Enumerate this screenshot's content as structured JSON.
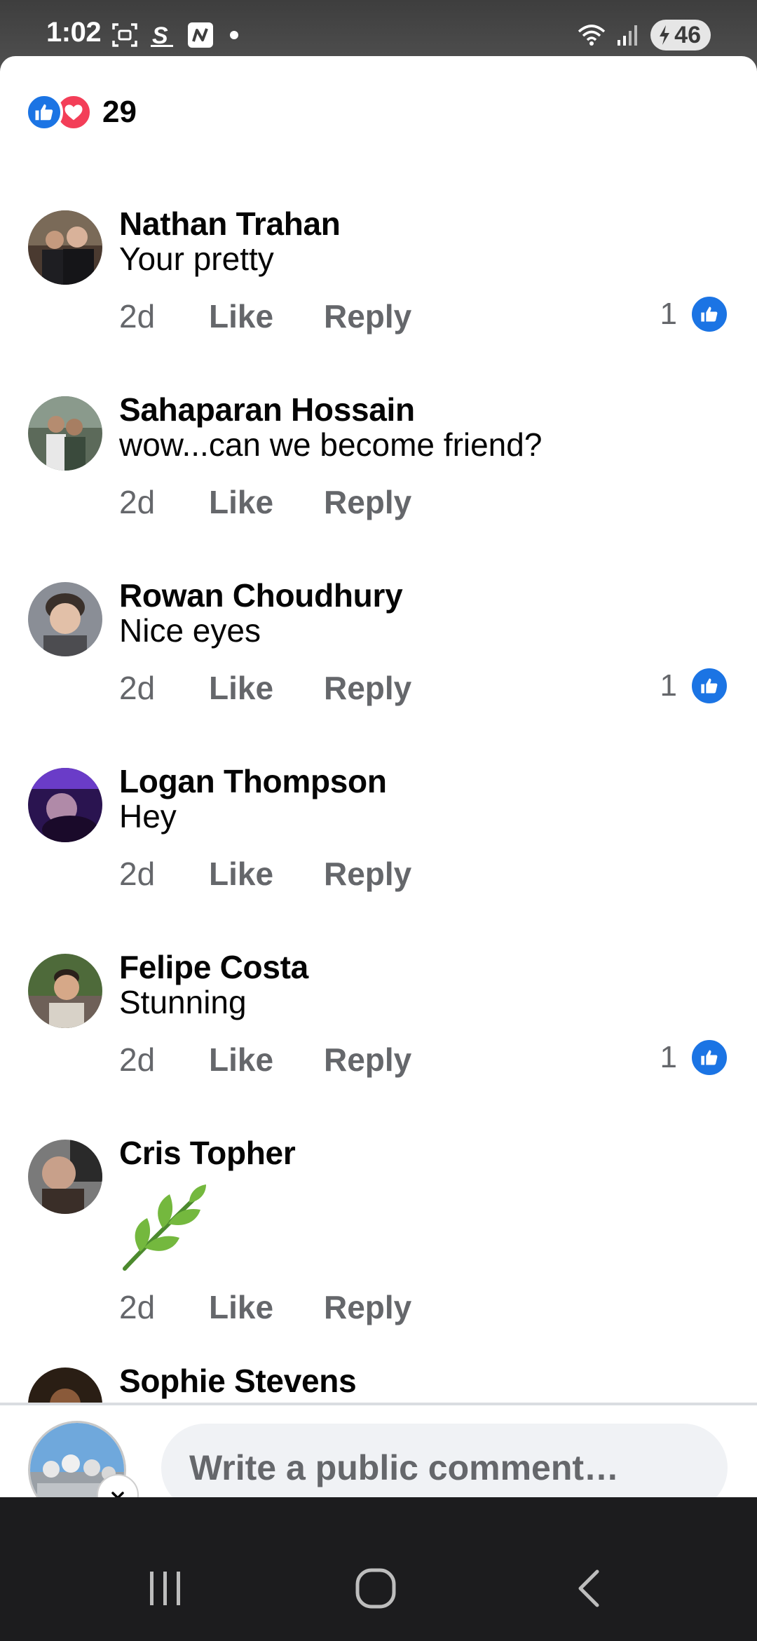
{
  "status_bar": {
    "time": "1:02",
    "left_icons": [
      "screenshot-icon",
      "s-app-icon",
      "n-app-icon",
      "notification-dot"
    ],
    "right_icons": [
      "wifi-icon",
      "signal-icon"
    ],
    "battery": "46"
  },
  "reactions": {
    "types": [
      "like",
      "love"
    ],
    "count": "29"
  },
  "comments": [
    {
      "name": "Nathan Trahan",
      "text": "Your pretty",
      "time": "2d",
      "like_label": "Like",
      "reply_label": "Reply",
      "reaction_count": "1"
    },
    {
      "name": "Sahaparan Hossain",
      "text": "wow...can we become friend?",
      "time": "2d",
      "like_label": "Like",
      "reply_label": "Reply",
      "reaction_count": ""
    },
    {
      "name": "Rowan Choudhury",
      "text": "Nice eyes",
      "time": "2d",
      "like_label": "Like",
      "reply_label": "Reply",
      "reaction_count": "1"
    },
    {
      "name": "Logan Thompson",
      "text": "Hey",
      "time": "2d",
      "like_label": "Like",
      "reply_label": "Reply",
      "reaction_count": ""
    },
    {
      "name": "Felipe Costa",
      "text": "Stunning",
      "time": "2d",
      "like_label": "Like",
      "reply_label": "Reply",
      "reaction_count": "1"
    },
    {
      "name": "Cris Topher",
      "text": "",
      "sticker": "leaf-sticker",
      "time": "2d",
      "like_label": "Like",
      "reply_label": "Reply",
      "reaction_count": ""
    },
    {
      "name": "Sophie Stevens",
      "text": "",
      "time": "",
      "like_label": "",
      "reply_label": "",
      "reaction_count": ""
    }
  ],
  "composer": {
    "placeholder": "Write a public comment…",
    "avatar_menu_icon": "chevron-down-icon"
  },
  "nav_bar": {
    "buttons": [
      "recents-icon",
      "home-icon",
      "back-icon"
    ]
  },
  "colors": {
    "facebook_blue": "#1b74e4",
    "love_red": "#f33e58",
    "secondary_text": "#65676b",
    "input_bg": "#f0f2f5"
  }
}
